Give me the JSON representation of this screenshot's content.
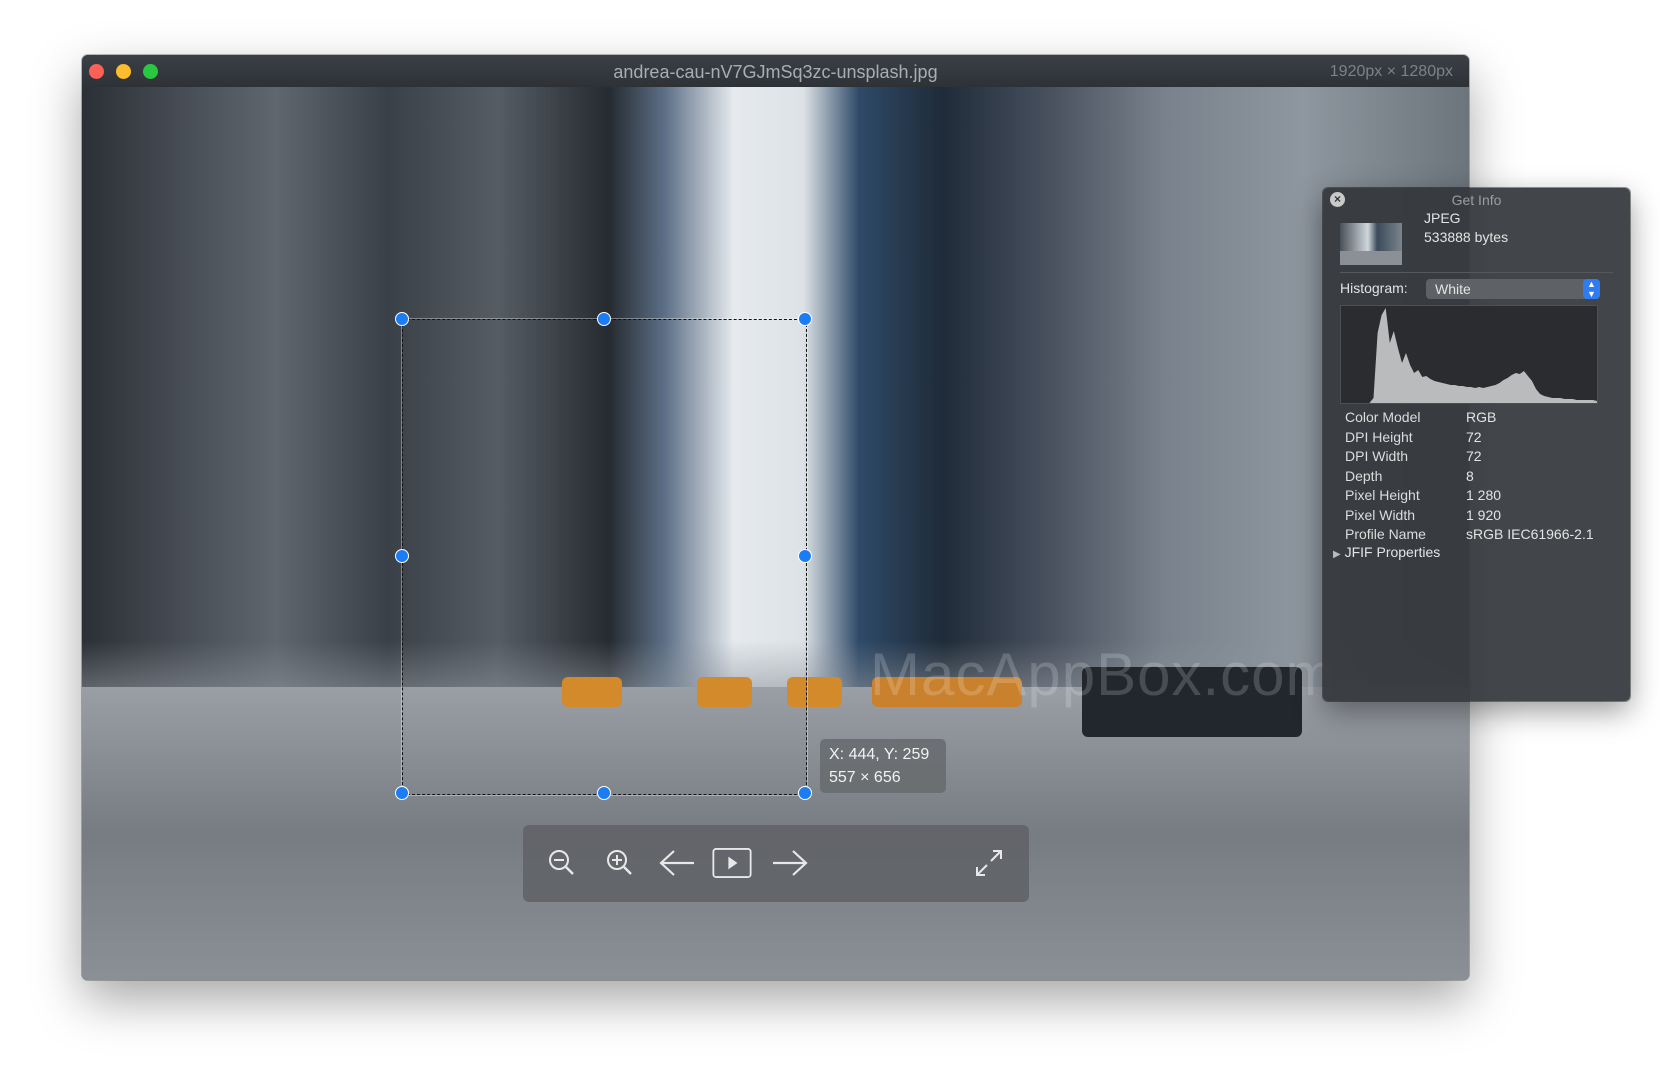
{
  "window": {
    "title": "andrea-cau-nV7GJmSq3zc-unsplash.jpg",
    "dimensions": "1920px × 1280px",
    "traffic_lights": {
      "close": "#fe5f57",
      "minimize": "#febc2e",
      "zoom": "#28c840"
    }
  },
  "selection": {
    "tooltip_position": "X: 444, Y: 259",
    "tooltip_size": "557 × 656",
    "handle_color": "#1c7cf4"
  },
  "toolbar": {
    "icons": [
      "zoom-out-icon",
      "zoom-in-icon",
      "arrow-left-icon",
      "play-icon",
      "arrow-right-icon",
      "fullscreen-icon"
    ]
  },
  "watermark": "MacAppBox.com",
  "info_panel": {
    "title": "Get Info",
    "file_type": "JPEG",
    "file_size": "533888 bytes",
    "histogram_label": "Histogram:",
    "histogram_channel": "White",
    "histogram_values": [
      0,
      0,
      0,
      0,
      0,
      0,
      0,
      0,
      5,
      70,
      88,
      95,
      60,
      72,
      55,
      40,
      50,
      38,
      30,
      33,
      26,
      27,
      24,
      22,
      21,
      20,
      19,
      18,
      18,
      17,
      17,
      16,
      16,
      15,
      16,
      15,
      16,
      17,
      18,
      20,
      23,
      25,
      28,
      30,
      29,
      32,
      27,
      22,
      14,
      9,
      7,
      6,
      5,
      5,
      5,
      4,
      4,
      4,
      3,
      3,
      3,
      3,
      3,
      2
    ],
    "properties": [
      {
        "key": "Color Model",
        "value": "RGB"
      },
      {
        "key": "DPI Height",
        "value": "72"
      },
      {
        "key": "DPI Width",
        "value": "72"
      },
      {
        "key": "Depth",
        "value": "8"
      },
      {
        "key": "Pixel Height",
        "value": "1 280"
      },
      {
        "key": "Pixel Width",
        "value": "1 920"
      },
      {
        "key": "Profile Name",
        "value": "sRGB IEC61966-2.1"
      }
    ],
    "jfif_label": "JFIF Properties"
  }
}
